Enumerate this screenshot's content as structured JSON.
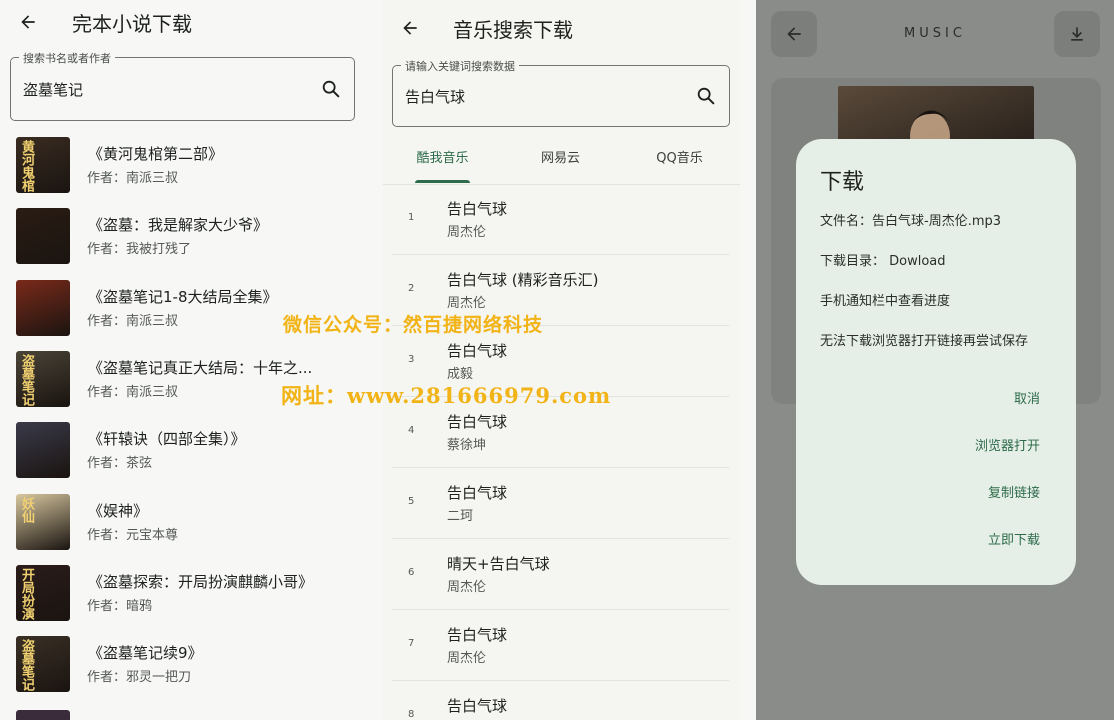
{
  "novel_app": {
    "title": "完本小说下载",
    "search": {
      "label": "搜索书名或者作者",
      "value": "盗墓笔记"
    },
    "books": [
      {
        "title": "《黄河鬼棺第二部》",
        "author": "作者：南派三叔",
        "cover_text": "黄河鬼棺",
        "cover_color": "#3a2c22"
      },
      {
        "title": "《盗墓：我是解家大少爷》",
        "author": "作者：我被打残了",
        "cover_text": "",
        "cover_color": "#2a1c14"
      },
      {
        "title": "《盗墓笔记1-8大结局全集》",
        "author": "作者：南派三叔",
        "cover_text": "",
        "cover_color": "#7a2a1a"
      },
      {
        "title": "《盗墓笔记真正大结局：十年之...",
        "author": "作者：南派三叔",
        "cover_text": "盗墓笔记",
        "cover_color": "#4a4438"
      },
      {
        "title": "《轩辕诀（四部全集）》",
        "author": "作者：茶弦",
        "cover_text": "",
        "cover_color": "#3a3a4a"
      },
      {
        "title": "《娱神》",
        "author": "作者：元宝本尊",
        "cover_text": "妖仙",
        "cover_color": "#d8c8a0"
      },
      {
        "title": "《盗墓探索：开局扮演麒麟小哥》",
        "author": "作者：暗鸦",
        "cover_text": "开局扮演",
        "cover_color": "#2a1c1a"
      },
      {
        "title": "《盗墓笔记续9》",
        "author": "作者：邪灵一把刀",
        "cover_text": "盗墓笔记",
        "cover_color": "#3a3026"
      }
    ]
  },
  "music_app": {
    "title": "音乐搜索下载",
    "search": {
      "label": "请输入关键词搜索数据",
      "value": "告白气球"
    },
    "tabs": [
      "酷我音乐",
      "网易云",
      "QQ音乐"
    ],
    "active_tab": 0,
    "songs": [
      {
        "num": "1",
        "title": "告白气球",
        "artist": "周杰伦"
      },
      {
        "num": "2",
        "title": "告白气球 (精彩音乐汇)",
        "artist": "周杰伦"
      },
      {
        "num": "3",
        "title": "告白气球",
        "artist": "成毅"
      },
      {
        "num": "4",
        "title": "告白气球",
        "artist": "蔡徐坤"
      },
      {
        "num": "5",
        "title": "告白气球",
        "artist": "二珂"
      },
      {
        "num": "6",
        "title": "晴天+告白气球",
        "artist": "周杰伦"
      },
      {
        "num": "7",
        "title": "告白气球",
        "artist": "周杰伦"
      },
      {
        "num": "8",
        "title": "告白气球",
        "artist": ""
      }
    ]
  },
  "player": {
    "title": "MUSIC",
    "dialog": {
      "title": "下载",
      "filename": "文件名：告白气球-周杰伦.mp3",
      "directory": "下载目录： Dowload",
      "hint1": "手机通知栏中查看进度",
      "hint2": "无法下载浏览器打开链接再尝试保存",
      "actions": [
        "取消",
        "浏览器打开",
        "复制链接",
        "立即下载"
      ]
    }
  },
  "watermark": {
    "line1": "微信公众号：然百捷网络科技",
    "line2": "网址：www.281666979.com"
  },
  "colors": {
    "accent": "#2e6b4a",
    "watermark": "#f2b317",
    "scrim": "#8a8c89",
    "dialog": "#e5efe7"
  }
}
